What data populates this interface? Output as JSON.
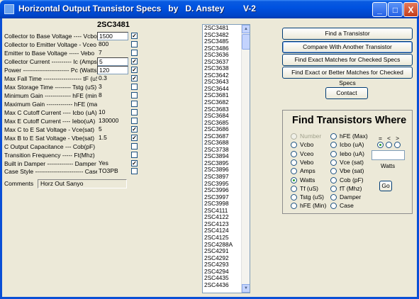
{
  "window": {
    "title": "Horizontal Output Transistor Specs   by   D. Anstey        V-2",
    "minimize": "_",
    "maximize": "□",
    "close": "X"
  },
  "model": "2SC3481",
  "params": [
    {
      "label": "Collector to Base Voltage ---- Vcbo",
      "value": "1500",
      "checked": true,
      "boxed": true
    },
    {
      "label": "Collector to Emitter Voltage - Vceo",
      "value": "800",
      "checked": false,
      "boxed": false
    },
    {
      "label": "Emitter to Base Voltage ----- Vebo",
      "value": "7",
      "checked": false,
      "boxed": false
    },
    {
      "label": "Collector Current ---------- Ic (Amps)",
      "value": "5",
      "checked": true,
      "boxed": true
    },
    {
      "label": "Power ----------------------- Pc (Watts)",
      "value": "120",
      "checked": true,
      "boxed": true
    },
    {
      "label": "Max Fall Time ------------------- tF (uS)",
      "value": "0.3",
      "checked": true,
      "boxed": false
    },
    {
      "label": "Max Storage Time -------- Tstg (uS)",
      "value": "3",
      "checked": false,
      "boxed": false
    },
    {
      "label": "Minimum Gain ------------- hFE (min)",
      "value": "8",
      "checked": false,
      "boxed": false
    },
    {
      "label": "Maximum Gain ------------- hFE (max)",
      "value": "",
      "checked": false,
      "boxed": false
    },
    {
      "label": "Max C Cutoff Current ---- Icbo (uA)",
      "value": "10",
      "checked": false,
      "boxed": false
    },
    {
      "label": "Max E Cutoff Current ---- Iebo(uA)",
      "value": "130000",
      "checked": false,
      "boxed": false
    },
    {
      "label": "Max C to E Sat Voltage - Vce(sat)",
      "value": "5",
      "checked": true,
      "boxed": false
    },
    {
      "label": "Max B to E Sat Voltage - Vbe(sat)",
      "value": "1.5",
      "checked": true,
      "boxed": false
    },
    {
      "label": "C Output Capacitance --- Cob(pF)",
      "value": "",
      "checked": false,
      "boxed": false
    },
    {
      "label": "Transition Frequency ----- Ft(Mhz)",
      "value": "",
      "checked": false,
      "boxed": false
    },
    {
      "label": "Built in Damper ------------- Damper",
      "value": "Yes",
      "checked": true,
      "boxed": false
    },
    {
      "label": "Case Style ------------------------ Case",
      "value": "TO3PB",
      "checked": false,
      "boxed": false
    }
  ],
  "comments": {
    "label": "Comments",
    "value": "Horz Out   Sanyo"
  },
  "list": {
    "items": [
      "2SC3481",
      "2SC3482",
      "2SC3485",
      "2SC3486",
      "2SC3636",
      "2SC3637",
      "2SC3638",
      "2SC3642",
      "2SC3643",
      "2SC3644",
      "2SC3681",
      "2SC3682",
      "2SC3683",
      "2SC3684",
      "2SC3685",
      "2SC3686",
      "2SC3687",
      "2SC3688",
      "2SC3738",
      "2SC3894",
      "2SC3895",
      "2SC3896",
      "2SC3897",
      "2SC3995",
      "2SC3996",
      "2SC3997",
      "2SC3998",
      "2SC4111",
      "2SC4122",
      "2SC4123",
      "2SC4124",
      "2SC4125",
      "2SC4288A",
      "2SC4291",
      "2SC4292",
      "2SC4293",
      "2SC4294",
      "2SC4435",
      "2SC4436"
    ],
    "scroll_up": "▲",
    "scroll_down": "▼"
  },
  "buttons": {
    "find": "Find a Transistor",
    "compare": "Compare With Another Transistor",
    "exact": "Find Exact Matches for Checked Specs",
    "exact_better": "Find Exact or Better Matches for Checked Specs",
    "contact": "Contact",
    "go": "Go"
  },
  "find_panel": {
    "title": "Find Transistors Where",
    "col1": [
      {
        "label": "Number",
        "disabled": true,
        "selected": false
      },
      {
        "label": "Vcbo",
        "disabled": false,
        "selected": false
      },
      {
        "label": "Vceo",
        "disabled": false,
        "selected": false
      },
      {
        "label": "Vebo",
        "disabled": false,
        "selected": false
      },
      {
        "label": "Amps",
        "disabled": false,
        "selected": false
      },
      {
        "label": "Watts",
        "disabled": false,
        "selected": true
      },
      {
        "label": "Tf (uS)",
        "disabled": false,
        "selected": false
      },
      {
        "label": "Tstg (uS)",
        "disabled": false,
        "selected": false
      },
      {
        "label": "hFE (Min)",
        "disabled": false,
        "selected": false
      }
    ],
    "col2": [
      {
        "label": "hFE (Max)",
        "disabled": false,
        "selected": false
      },
      {
        "label": "Icbo (uA)",
        "disabled": false,
        "selected": false
      },
      {
        "label": "Iebo (uA)",
        "disabled": false,
        "selected": false
      },
      {
        "label": "Vce (sat)",
        "disabled": false,
        "selected": false
      },
      {
        "label": "Vbe (sat)",
        "disabled": false,
        "selected": false
      },
      {
        "label": "Cob (pF)",
        "disabled": false,
        "selected": false
      },
      {
        "label": "fT (Mhz)",
        "disabled": false,
        "selected": false
      },
      {
        "label": "Damper",
        "disabled": false,
        "selected": false
      },
      {
        "label": "Case",
        "disabled": false,
        "selected": false
      }
    ],
    "comparison_symbols": "=   <   >",
    "comparison_selected": "=",
    "value": "",
    "unit": "Watts"
  }
}
